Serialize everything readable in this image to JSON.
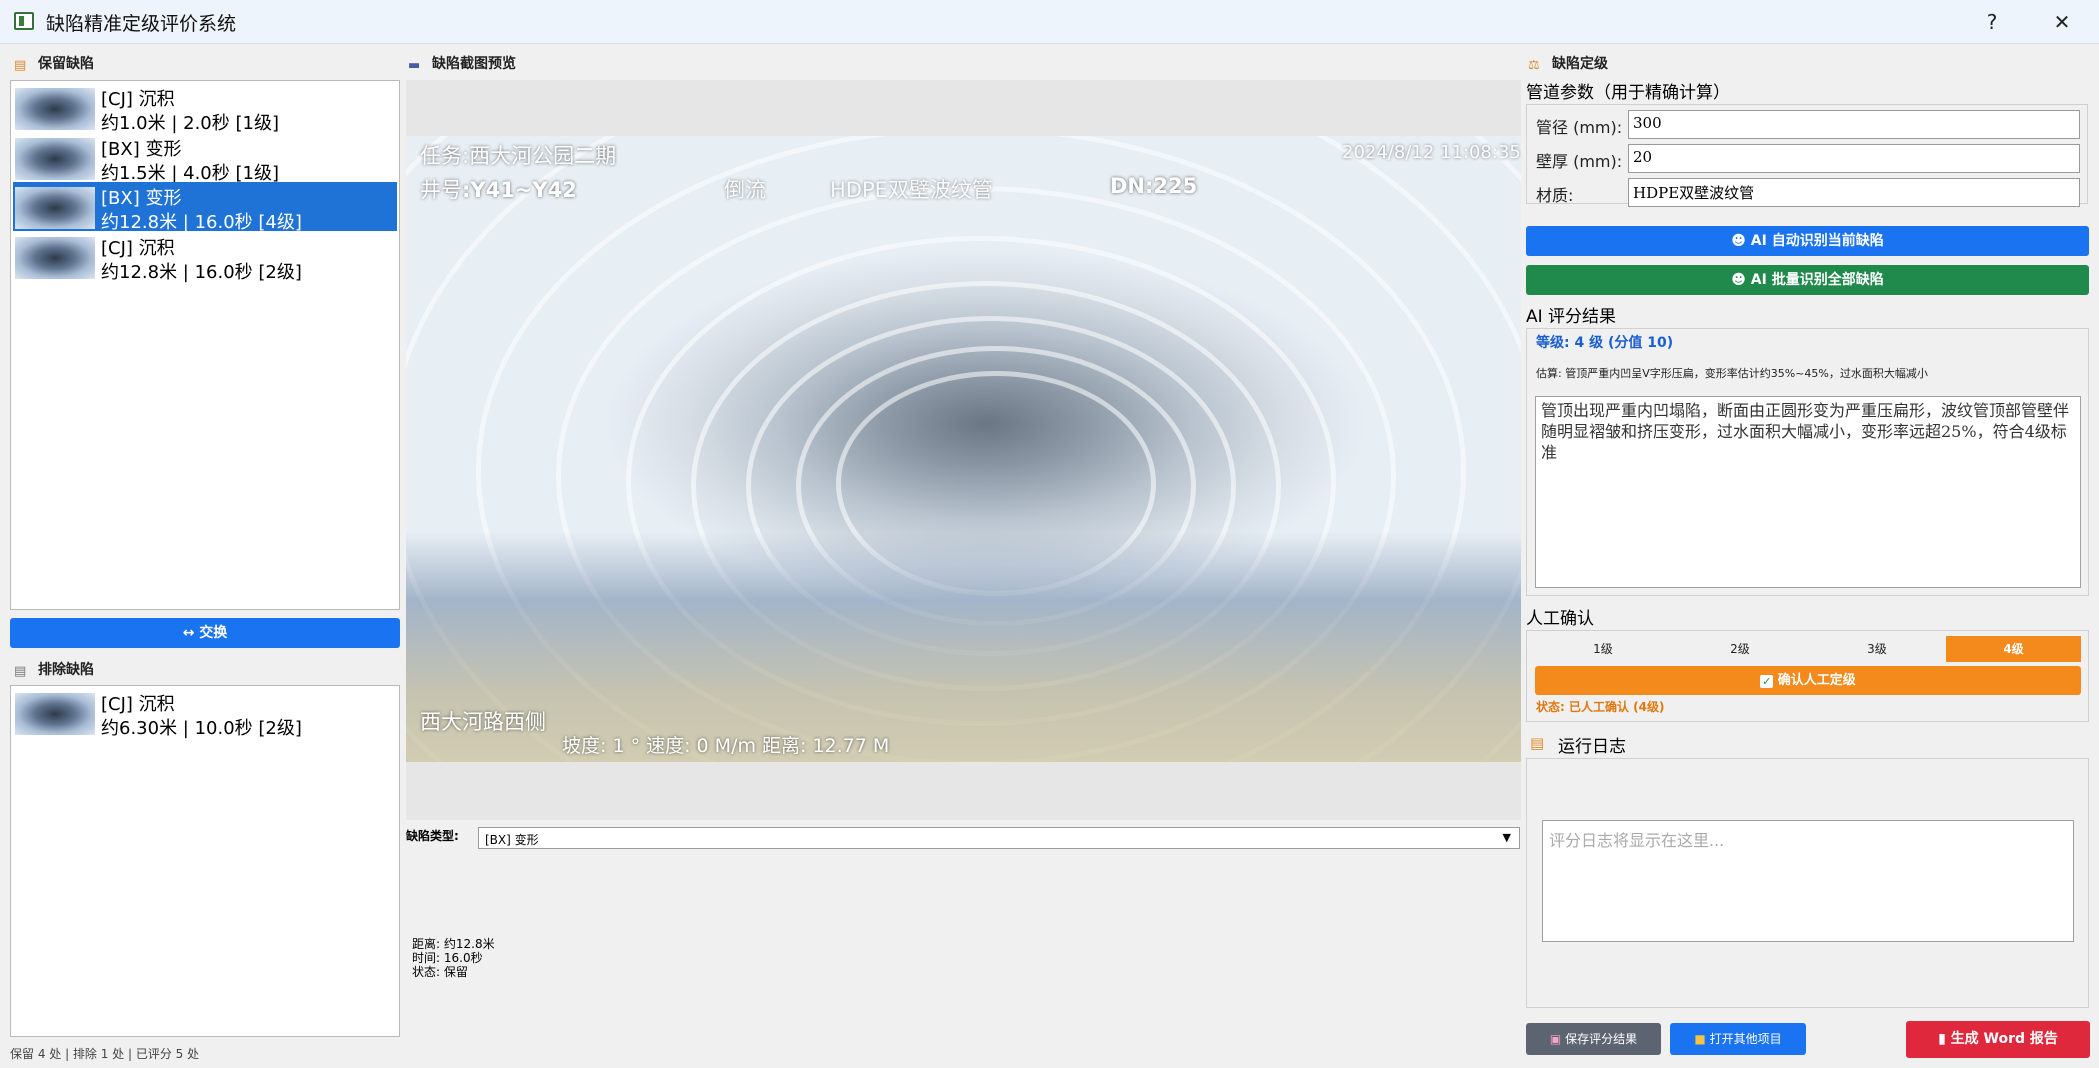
{
  "window": {
    "title": "缺陷精准定级评价系统",
    "help_label": "?",
    "close_label": "✕"
  },
  "retained": {
    "header": "保留缺陷",
    "items": [
      {
        "line1": "[CJ] 沉积",
        "line2": "约1.0米 | 2.0秒 [1级]"
      },
      {
        "line1": "[BX] 变形",
        "line2": "约1.5米 | 4.0秒 [1级]"
      },
      {
        "line1": "[BX] 变形",
        "line2": "约12.8米 | 16.0秒 [4级]"
      },
      {
        "line1": "[CJ] 沉积",
        "line2": "约12.8米 | 16.0秒 [2级]"
      }
    ],
    "selected_index": 2
  },
  "swap_button": "↔ 交换",
  "excluded": {
    "header": "排除缺陷",
    "items": [
      {
        "line1": "[CJ] 沉积",
        "line2": "约6.30米 | 10.0秒 [2级]"
      }
    ]
  },
  "status_bar": "保留 4 处 | 排除 1 处 | 已评分 5 处",
  "preview": {
    "header": "缺陷截图预览",
    "osd": {
      "task": "任务:西大河公园二期",
      "datetime": "2024/8/12 11:08:35",
      "well_prefix": "井号",
      "well": ":Y41~Y42",
      "dir": "倒流",
      "pipe": "HDPE双壁波纹管",
      "dn": "DN:225",
      "location": "西大河路西侧",
      "metrics": "坡度: 1 °  速度: 0 M/m 距离: 12.77 M"
    },
    "defect_type_label": "缺陷类型:",
    "defect_type_value": "[BX] 变形",
    "info": [
      {
        "k": "距离:",
        "v": "约12.8米"
      },
      {
        "k": "时间:",
        "v": "16.0秒"
      },
      {
        "k": "状态:",
        "v": "保留"
      }
    ]
  },
  "grading": {
    "header": "缺陷定级",
    "pipe_params_title": "管道参数（用于精确计算）",
    "fields": [
      {
        "label": "管径 (mm):",
        "value": "300"
      },
      {
        "label": "壁厚 (mm):",
        "value": "20"
      },
      {
        "label": "材质:",
        "value": "HDPE双壁波纹管"
      }
    ],
    "ai_identify_current": "AI 自动识别当前缺陷",
    "ai_identify_all": "AI 批量识别全部缺陷",
    "ai_result_title": "AI 评分结果",
    "grade_line": "等级: 4 级 (分值 10)",
    "estimate_line": "估算: 管顶严重内凹呈V字形压扁，变形率估计约35%~45%，过水面积大幅减小",
    "description": "管顶出现严重内凹塌陷，断面由正圆形变为严重压扁形，波纹管顶部管壁伴随明显褶皱和挤压变形，过水面积大幅减小，变形率远超25%，符合4级标准",
    "manual_title": "人工确认",
    "grade_options": [
      "1级",
      "2级",
      "3级",
      "4级"
    ],
    "selected_grade_index": 3,
    "confirm_button": "确认人工定级",
    "status_line": "状态: 已人工确认 (4级)",
    "log_title": "运行日志",
    "log_placeholder": "评分日志将显示在这里..."
  },
  "bottom_buttons": {
    "save": "保存评分结果",
    "open": "打开其他项目",
    "report": "生成 Word 报告"
  },
  "colors": {
    "accent": "#1a73f0",
    "green": "#1f8a4c",
    "orange": "#f58a1c",
    "report": "#e0283c",
    "selected": "#1f73d6"
  }
}
